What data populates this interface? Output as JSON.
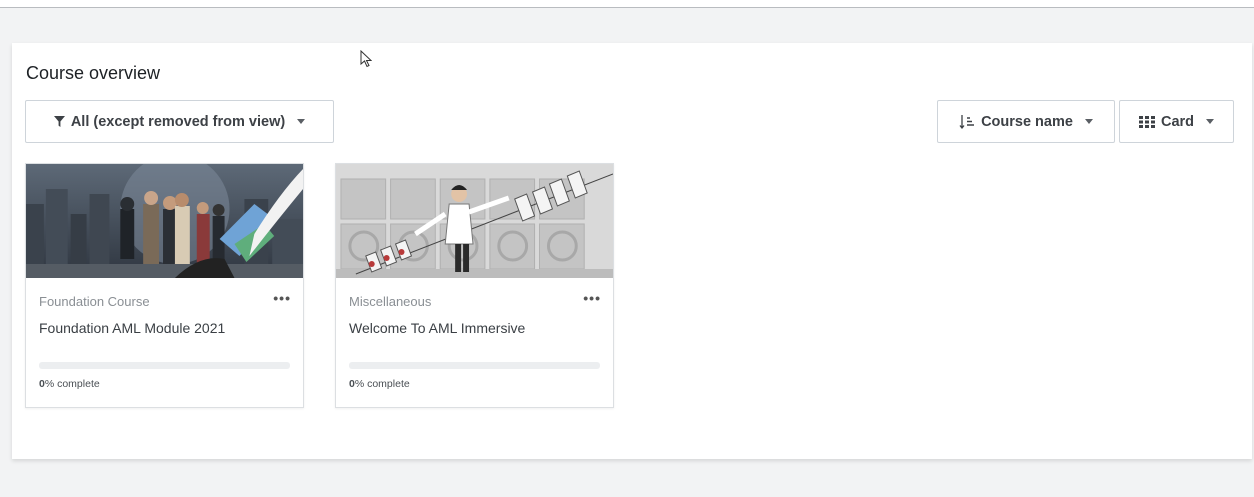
{
  "block": {
    "title": "Course overview"
  },
  "filter": {
    "label": "All (except removed from view)"
  },
  "sort": {
    "label": "Course name"
  },
  "view": {
    "label": "Card"
  },
  "courses": [
    {
      "category": "Foundation Course",
      "name": "Foundation AML Module 2021",
      "progress_percent": 0,
      "progress_value": "0",
      "progress_suffix": "% complete"
    },
    {
      "category": "Miscellaneous",
      "name": "Welcome To AML Immersive",
      "progress_percent": 0,
      "progress_value": "0",
      "progress_suffix": "% complete"
    }
  ],
  "icons": {
    "filter": "filter-icon",
    "sort": "sort-icon",
    "view": "grid-icon",
    "menu": "ellipsis-icon"
  },
  "colors": {
    "accent": "#0f6cbf",
    "background": "#f2f3f4"
  }
}
